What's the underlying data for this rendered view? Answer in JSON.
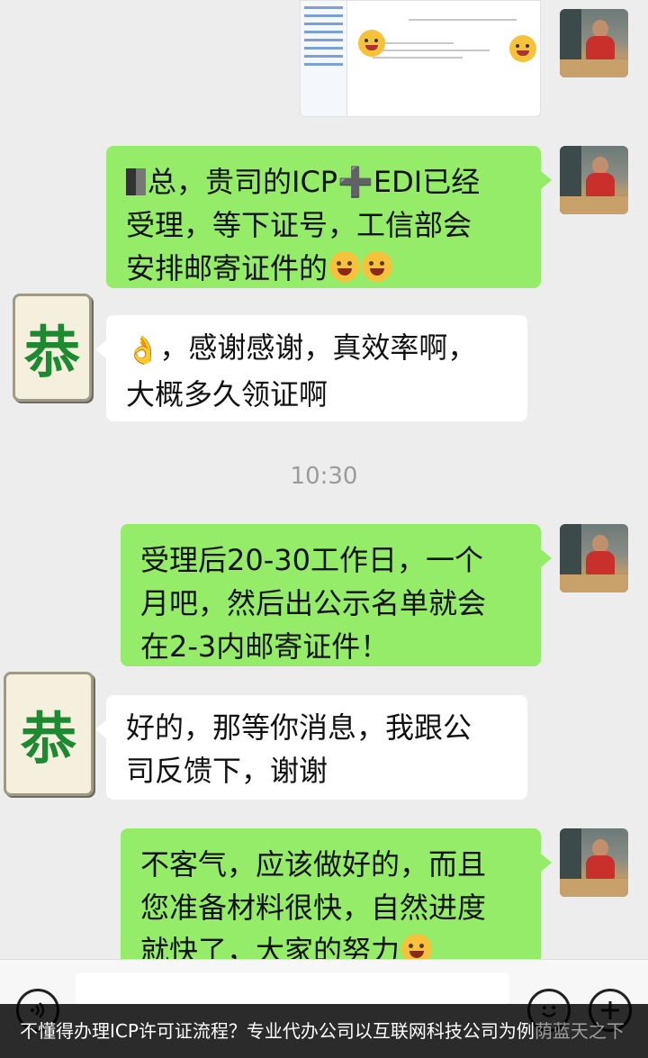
{
  "messages": [
    {
      "id": "m1",
      "side": "right",
      "lines": [
        "总，贵司的ICP➕EDI已经",
        "受理，等下证号，工信部会",
        "安排邮寄证件的"
      ]
    },
    {
      "id": "m2",
      "side": "left",
      "lines": [
        "，感谢感谢，真效率啊，",
        "大概多久领证啊"
      ]
    },
    {
      "id": "m3",
      "side": "right",
      "lines": [
        "受理后20-30工作日，一个",
        "月吧，然后出公示名单就会",
        "在2-3内邮寄证件！"
      ]
    },
    {
      "id": "m4",
      "side": "left",
      "lines": [
        "好的，那等你消息，我跟公",
        "司反馈下，谢谢"
      ]
    },
    {
      "id": "m5",
      "side": "right",
      "lines": [
        "不客气，应该做好的，而且",
        "您准备材料很快，自然进度",
        "就快了，大家的努力"
      ]
    }
  ],
  "timestamp": "10:30",
  "contact_avatar_char": "恭",
  "caption": {
    "main": "不懂得办理ICP许可证流程？专业代办公司以互联网科技公司为例",
    "faded": "荫蓝天之下"
  },
  "icons": {
    "voice": "voice-icon",
    "emoji": "emoji-icon",
    "plus": "plus-icon"
  },
  "colors": {
    "sent_bubble": "#95ec69",
    "received_bubble": "#ffffff",
    "background": "#ededed",
    "avatar_char": "#1d8a32"
  }
}
